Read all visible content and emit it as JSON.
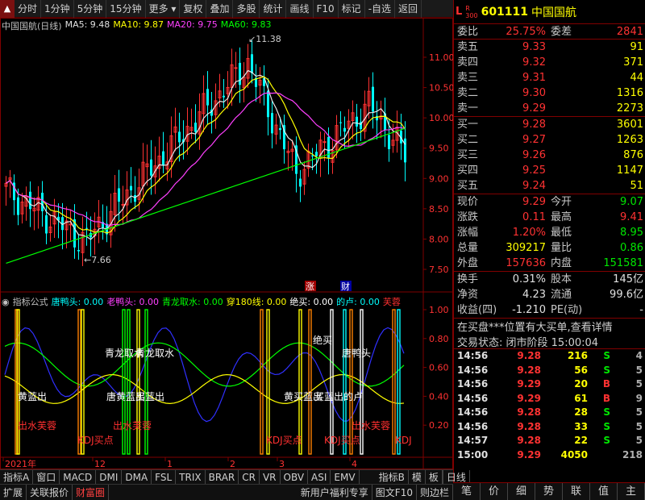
{
  "toolbar": {
    "items": [
      "分时",
      "1分钟",
      "5分钟",
      "15分钟",
      "更多",
      "复权",
      "叠加",
      "多股",
      "统计",
      "画线",
      "F10",
      "标记",
      "-自选",
      "返回"
    ]
  },
  "main_header": {
    "title": "中国国航(日线)",
    "ma5": "MA5: 9.48",
    "ma10": "MA10: 9.87",
    "ma20": "MA20: 9.75",
    "ma60": "MA60: 9.83",
    "high_label": "11.38",
    "low_label": "7.66"
  },
  "ind_header": {
    "name": "指标公式",
    "items": [
      {
        "text": "唐鸭头: 0.00",
        "color": "#00ffff"
      },
      {
        "text": "老鸭头: 0.00",
        "color": "#ff40ff"
      },
      {
        "text": "青龙取水: 0.00",
        "color": "#00ff00"
      },
      {
        "text": "穿180线: 0.00",
        "color": "#ffff00"
      },
      {
        "text": "绝买: 0.00",
        "color": "#ffffff"
      },
      {
        "text": "的卢: 0.00",
        "color": "#00ffff"
      },
      {
        "text": "芙蓉",
        "color": "#ff3030"
      }
    ],
    "badge_zhang": "涨",
    "badge_cai": "财"
  },
  "price_axis": [
    "11.00",
    "10.50",
    "10.00",
    "9.50",
    "9.00",
    "8.50",
    "8.00",
    "7.50"
  ],
  "ind_axis": [
    "1.00",
    "0.80",
    "0.60",
    "0.40",
    "0.20"
  ],
  "time_axis": [
    "2021年",
    "12",
    "1",
    "2",
    "3",
    "4"
  ],
  "ind_labels": [
    {
      "text": "青龙取水",
      "cls": "w"
    },
    {
      "text": "青龙取水",
      "cls": "w"
    },
    {
      "text": "绝买",
      "cls": "w"
    },
    {
      "text": "唐鸭头",
      "cls": "w"
    },
    {
      "text": "黄蓝出",
      "cls": "w"
    },
    {
      "text": "唐黄蓝出",
      "cls": "w"
    },
    {
      "text": "买蓝出",
      "cls": "w"
    },
    {
      "text": "黄买蓝出",
      "cls": "w"
    },
    {
      "text": "买蓝出的卢",
      "cls": "w"
    },
    {
      "text": "出水芙蓉",
      "cls": "r"
    },
    {
      "text": "出水芙蓉",
      "cls": "r"
    },
    {
      "text": "出水芙蓉",
      "cls": "r"
    },
    {
      "text": "KDJ买点",
      "cls": "r"
    },
    {
      "text": "KDJ买点",
      "cls": "r"
    },
    {
      "text": "KDJ买点",
      "cls": "r"
    },
    {
      "text": "KDJ",
      "cls": "r"
    }
  ],
  "quote": {
    "label_l": "L",
    "label_r": "R",
    "label_300": "300",
    "code": "601111",
    "name": "中国国航",
    "weibi_label": "委比",
    "weibi": "25.75%",
    "weicha_label": "委差",
    "weicha": "2841",
    "asks": [
      {
        "label": "卖五",
        "price": "9.33",
        "vol": "91"
      },
      {
        "label": "卖四",
        "price": "9.32",
        "vol": "371"
      },
      {
        "label": "卖三",
        "price": "9.31",
        "vol": "44"
      },
      {
        "label": "卖二",
        "price": "9.30",
        "vol": "1316"
      },
      {
        "label": "卖一",
        "price": "9.29",
        "vol": "2273"
      }
    ],
    "bids": [
      {
        "label": "买一",
        "price": "9.28",
        "vol": "3601"
      },
      {
        "label": "买二",
        "price": "9.27",
        "vol": "1263"
      },
      {
        "label": "买三",
        "price": "9.26",
        "vol": "876"
      },
      {
        "label": "买四",
        "price": "9.25",
        "vol": "1147"
      },
      {
        "label": "买五",
        "price": "9.24",
        "vol": "51"
      }
    ],
    "stats": [
      {
        "l1": "现价",
        "v1": "9.29",
        "c1": "red",
        "l2": "今开",
        "v2": "9.07",
        "c2": "green"
      },
      {
        "l1": "涨跌",
        "v1": "0.11",
        "c1": "red",
        "l2": "最高",
        "v2": "9.41",
        "c2": "red"
      },
      {
        "l1": "涨幅",
        "v1": "1.20%",
        "c1": "red",
        "l2": "最低",
        "v2": "8.95",
        "c2": "green"
      },
      {
        "l1": "总量",
        "v1": "309217",
        "c1": "yellow",
        "l2": "量比",
        "v2": "0.86",
        "c2": "green"
      },
      {
        "l1": "外盘",
        "v1": "157636",
        "c1": "red",
        "l2": "内盘",
        "v2": "151581",
        "c2": "green"
      }
    ],
    "stats2": [
      {
        "l1": "换手",
        "v1": "0.31%",
        "c1": "white",
        "l2": "股本",
        "v2": "145亿",
        "c2": "white"
      },
      {
        "l1": "净资",
        "v1": "4.23",
        "c1": "white",
        "l2": "流通",
        "v2": "99.6亿",
        "c2": "white"
      },
      {
        "l1": "收益(四)",
        "v1": "-1.210",
        "c1": "white",
        "l2": "PE(动)",
        "v2": "-",
        "c2": "white"
      }
    ],
    "status_line1": "在买盘***位置有大买单,查看详情",
    "status_line2_label": "交易状态: 闭市阶段",
    "status_time": "15:00:04",
    "ticks": [
      {
        "t": "14:56",
        "p": "9.28",
        "q": "216",
        "bs": "S",
        "bsc": "green",
        "x": "4"
      },
      {
        "t": "14:56",
        "p": "9.28",
        "q": "56",
        "bs": "S",
        "bsc": "green",
        "x": "5"
      },
      {
        "t": "14:56",
        "p": "9.29",
        "q": "20",
        "bs": "B",
        "bsc": "red",
        "x": "5"
      },
      {
        "t": "14:56",
        "p": "9.29",
        "q": "61",
        "bs": "B",
        "bsc": "red",
        "x": "9"
      },
      {
        "t": "14:56",
        "p": "9.28",
        "q": "28",
        "bs": "S",
        "bsc": "green",
        "x": "5"
      },
      {
        "t": "14:56",
        "p": "9.28",
        "q": "33",
        "bs": "S",
        "bsc": "green",
        "x": "5"
      },
      {
        "t": "14:57",
        "p": "9.28",
        "q": "22",
        "bs": "S",
        "bsc": "green",
        "x": "5"
      },
      {
        "t": "15:00",
        "p": "9.29",
        "q": "4050",
        "bs": "",
        "bsc": "magenta",
        "x": "218"
      }
    ]
  },
  "tabs1": [
    "指标A",
    "窗口",
    "MACD",
    "DMI",
    "DMA",
    "FSL",
    "TRIX",
    "BRAR",
    "CR",
    "VR",
    "OBV",
    "ASI",
    "EMV",
    "指标B",
    "模",
    "板"
  ],
  "tabs2": [
    "扩展",
    "关联报价",
    "财富圈",
    "新用户福利专享",
    "图文F10",
    "则边栏"
  ],
  "day_line_label": "日线",
  "qtabs": [
    "笔",
    "价",
    "细",
    "势",
    "联",
    "值",
    "主"
  ]
}
